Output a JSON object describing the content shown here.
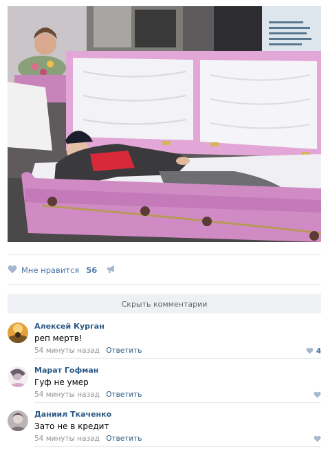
{
  "post": {
    "likes_label": "Мне нравится",
    "likes_count": "56",
    "icons": {
      "like": "heart-icon",
      "share": "megaphone-icon"
    }
  },
  "comments_toggle": {
    "label": "Скрыть комментарии"
  },
  "comments": [
    {
      "author": "Алексей Курган",
      "text": "реп мертв!",
      "time": "54 минуты назад",
      "reply": "Ответить",
      "likes": "4"
    },
    {
      "author": "Марат Гофман",
      "text": "Гуф не умер",
      "time": "54 минуты назад",
      "reply": "Ответить",
      "likes": ""
    },
    {
      "author": "Даниил Ткаченко",
      "text": "Зато не в кредит",
      "time": "54 минуты назад",
      "reply": "Ответить",
      "likes": ""
    }
  ],
  "colors": {
    "link": "#2a5885",
    "like": "#4a76a8",
    "muted": "#939393",
    "button_bg": "#eef0f3"
  }
}
